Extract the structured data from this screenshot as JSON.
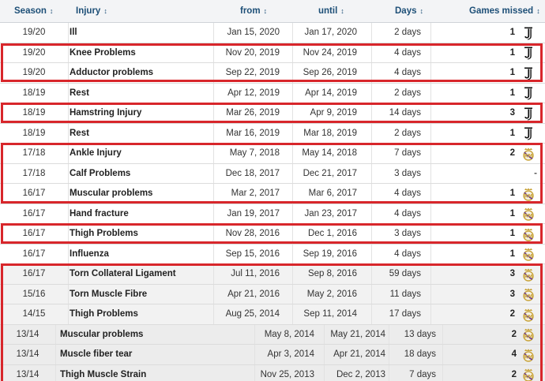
{
  "header": {
    "season": "Season",
    "injury": "Injury",
    "from": "from",
    "until": "until",
    "days": "Days",
    "games_missed": "Games missed",
    "sort_glyph": "↕"
  },
  "rows": [
    {
      "season": "19/20",
      "injury": "Ill",
      "from": "Jan 15, 2020",
      "until": "Jan 17, 2020",
      "days": "2 days",
      "games": "1",
      "club": "juventus-logo"
    },
    {
      "season": "19/20",
      "injury": "Knee Problems",
      "from": "Nov 20, 2019",
      "until": "Nov 24, 2019",
      "days": "4 days",
      "games": "1",
      "club": "juventus-logo"
    },
    {
      "season": "19/20",
      "injury": "Adductor problems",
      "from": "Sep 22, 2019",
      "until": "Sep 26, 2019",
      "days": "4 days",
      "games": "1",
      "club": "juventus-logo"
    },
    {
      "season": "18/19",
      "injury": "Rest",
      "from": "Apr 12, 2019",
      "until": "Apr 14, 2019",
      "days": "2 days",
      "games": "1",
      "club": "juventus-logo"
    },
    {
      "season": "18/19",
      "injury": "Hamstring Injury",
      "from": "Mar 26, 2019",
      "until": "Apr 9, 2019",
      "days": "14 days",
      "games": "3",
      "club": "juventus-logo"
    },
    {
      "season": "18/19",
      "injury": "Rest",
      "from": "Mar 16, 2019",
      "until": "Mar 18, 2019",
      "days": "2 days",
      "games": "1",
      "club": "juventus-logo"
    },
    {
      "season": "17/18",
      "injury": "Ankle Injury",
      "from": "May 7, 2018",
      "until": "May 14, 2018",
      "days": "7 days",
      "games": "2",
      "club": "real-madrid-logo"
    },
    {
      "season": "17/18",
      "injury": "Calf Problems",
      "from": "Dec 18, 2017",
      "until": "Dec 21, 2017",
      "days": "3 days",
      "games": "-",
      "club": ""
    },
    {
      "season": "16/17",
      "injury": "Muscular problems",
      "from": "Mar 2, 2017",
      "until": "Mar 6, 2017",
      "days": "4 days",
      "games": "1",
      "club": "real-madrid-logo"
    },
    {
      "season": "16/17",
      "injury": "Hand fracture",
      "from": "Jan 19, 2017",
      "until": "Jan 23, 2017",
      "days": "4 days",
      "games": "1",
      "club": "real-madrid-logo"
    },
    {
      "season": "16/17",
      "injury": "Thigh Problems",
      "from": "Nov 28, 2016",
      "until": "Dec 1, 2016",
      "days": "3 days",
      "games": "1",
      "club": "real-madrid-logo"
    },
    {
      "season": "16/17",
      "injury": "Influenza",
      "from": "Sep 15, 2016",
      "until": "Sep 19, 2016",
      "days": "4 days",
      "games": "1",
      "club": "real-madrid-logo"
    },
    {
      "season": "16/17",
      "injury": "Torn Collateral Ligament",
      "from": "Jul 11, 2016",
      "until": "Sep 8, 2016",
      "days": "59 days",
      "games": "3",
      "club": "real-madrid-logo"
    },
    {
      "season": "15/16",
      "injury": "Torn Muscle Fibre",
      "from": "Apr 21, 2016",
      "until": "May 2, 2016",
      "days": "11 days",
      "games": "3",
      "club": "real-madrid-logo"
    },
    {
      "season": "14/15",
      "injury": "Thigh Problems",
      "from": "Aug 25, 2014",
      "until": "Sep 11, 2014",
      "days": "17 days",
      "games": "2",
      "club": "real-madrid-logo"
    },
    {
      "season": "13/14",
      "injury": "Muscular problems",
      "from": "May 8, 2014",
      "until": "May 21, 2014",
      "days": "13 days",
      "games": "2",
      "club": "real-madrid-logo"
    },
    {
      "season": "13/14",
      "injury": "Muscle fiber tear",
      "from": "Apr 3, 2014",
      "until": "Apr 21, 2014",
      "days": "18 days",
      "games": "4",
      "club": "real-madrid-logo"
    },
    {
      "season": "13/14",
      "injury": "Thigh Muscle Strain",
      "from": "Nov 25, 2013",
      "until": "Dec 2, 2013",
      "days": "7 days",
      "games": "2",
      "club": "real-madrid-logo"
    }
  ],
  "colors": {
    "header_text": "#1d4f77",
    "highlight_box": "#d8262b",
    "real_madrid_gold": "#c9a43a",
    "juventus_black": "#111111"
  }
}
